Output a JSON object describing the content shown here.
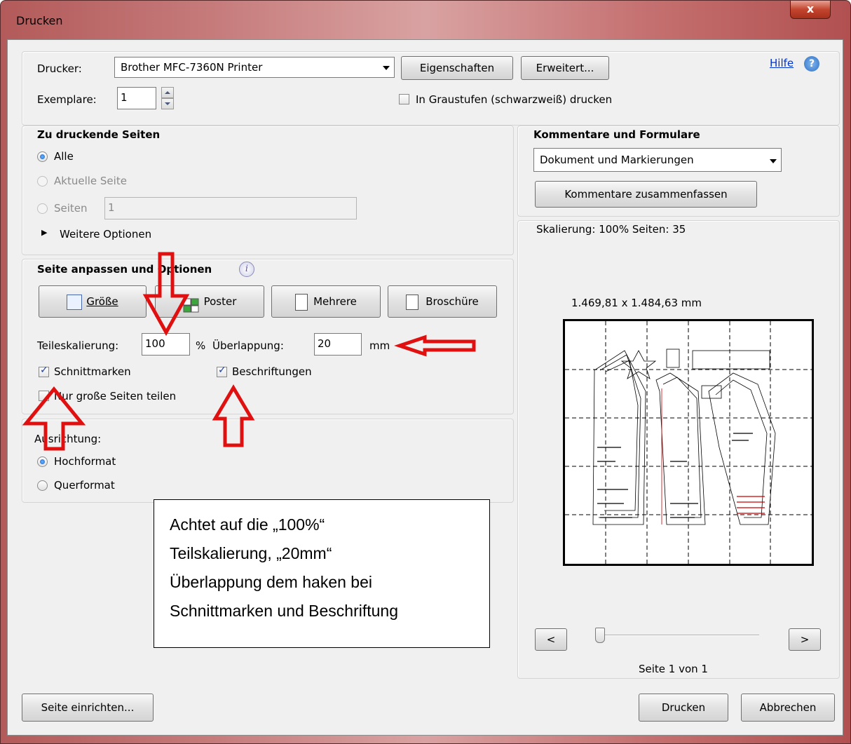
{
  "window": {
    "title": "Drucken",
    "close_label": "x"
  },
  "top": {
    "printer_label": "Drucker:",
    "printer_value": "Brother MFC-7360N Printer",
    "properties_button": "Eigenschaften",
    "advanced_button": "Erweitert...",
    "help_link": "Hilfe",
    "copies_label": "Exemplare:",
    "copies_value": "1",
    "grayscale_label": "In Graustufen (schwarzweiß) drucken",
    "grayscale_checked": false
  },
  "pages_group": {
    "title": "Zu druckende Seiten",
    "all_label": "Alle",
    "current_label": "Aktuelle Seite",
    "pages_label": "Seiten",
    "pages_value": "1",
    "more_options_label": "Weitere Optionen",
    "selected": "Alle"
  },
  "fit_group": {
    "title": "Seite anpassen und Optionen",
    "size_button": "Größe",
    "poster_button": "Poster",
    "multiple_button": "Mehrere",
    "booklet_button": "Broschüre",
    "tile_scale_label": "Teileskalierung:",
    "tile_scale_value": "100",
    "percent_unit": "%",
    "overlap_label": "Überlappung:",
    "overlap_value": "20",
    "overlap_unit": "mm",
    "cut_marks_label": "Schnittmarken",
    "cut_marks_checked": true,
    "labels_label": "Beschriftungen",
    "labels_checked": true,
    "large_pages_label": "Nur große Seiten teilen",
    "large_pages_checked": false
  },
  "orientation_group": {
    "title": "Ausrichtung:",
    "portrait_label": "Hochformat",
    "landscape_label": "Querformat",
    "selected": "Hochformat"
  },
  "comments_group": {
    "title": "Kommentare und Formulare",
    "dropdown_value": "Dokument und Markierungen",
    "summarize_button": "Kommentare zusammenfassen"
  },
  "preview": {
    "scaling_text": "Skalierung: 100% Seiten: 35",
    "dimensions_text": "1.469,81 x 1.484,63 mm",
    "prev_button": "<",
    "next_button": ">",
    "page_indicator": "Seite 1 von 1",
    "slider_value": 0
  },
  "bottom": {
    "page_setup_button": "Seite einrichten...",
    "print_button": "Drucken",
    "cancel_button": "Abbrechen"
  },
  "annotation": {
    "lines": [
      "Achtet auf die „100%“",
      "Teilskalierung, „20mm“",
      "Überlappung  dem haken bei",
      "Schnittmarken und Beschriftung"
    ],
    "arrow_color": "#e01010"
  }
}
